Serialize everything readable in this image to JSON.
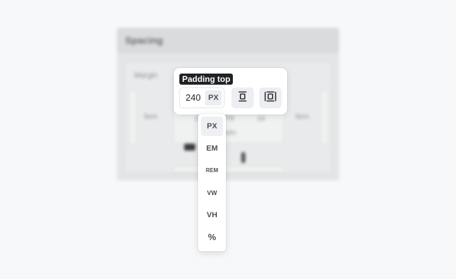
{
  "background": {
    "panel_title": "Spacing",
    "margin_label": "Margin",
    "side_left_value": "5em",
    "side_right_value": "5em",
    "inner_left_value": "24",
    "inner_right_value": "24",
    "padding_label": "Padding",
    "inner_sub_value": "auto"
  },
  "popover": {
    "tooltip": "Padding top",
    "value": "240",
    "unit": "PX",
    "icon_left": "align-top-icon",
    "icon_right": "padding-all-icon"
  },
  "unit_menu": {
    "selected": "PX",
    "options": [
      "PX",
      "EM",
      "REM",
      "VW",
      "VH",
      "%"
    ]
  },
  "colors": {
    "page_bg": "#f7f8f9",
    "tooltip_bg": "#1f2124",
    "button_bg": "#eceef1",
    "text_dark": "#1f2124",
    "text_muted": "#4a4e54"
  }
}
